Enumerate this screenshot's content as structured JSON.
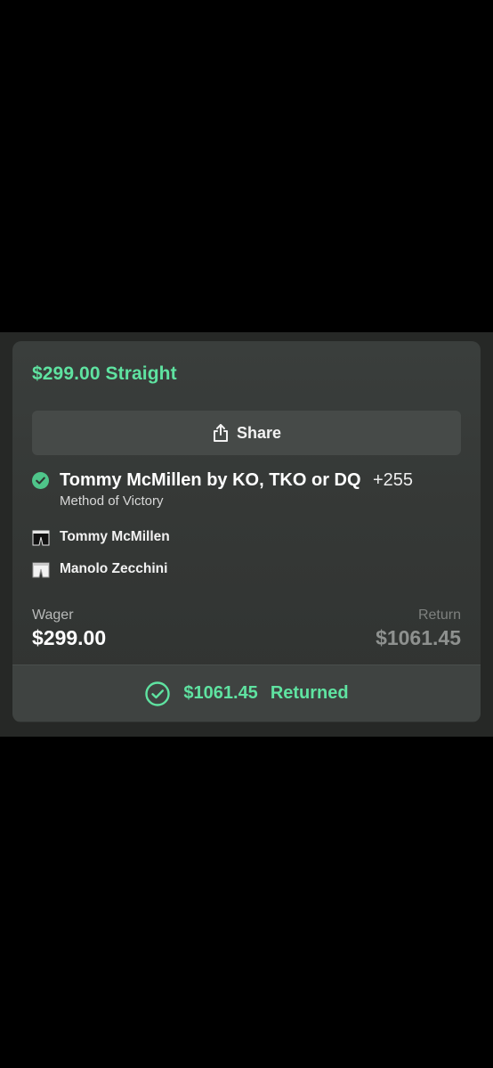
{
  "bet": {
    "title": "$299.00 Straight",
    "share_label": "Share",
    "selection": {
      "name": "Tommy McMillen by KO, TKO or DQ",
      "odds": "+255",
      "market": "Method of Victory"
    },
    "fighters": [
      {
        "name": "Tommy McMillen",
        "trunks_color": "#111111"
      },
      {
        "name": "Manolo Zecchini",
        "trunks_color": "#f2f2f2"
      }
    ],
    "wager_label": "Wager",
    "wager_value": "$299.00",
    "return_label": "Return",
    "return_value": "$1061.45",
    "result_amount": "$1061.45",
    "result_status": "Returned"
  },
  "colors": {
    "accent": "#5fe3a1",
    "check_badge": "#4fc58a",
    "card_bg": "#353836",
    "page_bg": "#000000"
  }
}
